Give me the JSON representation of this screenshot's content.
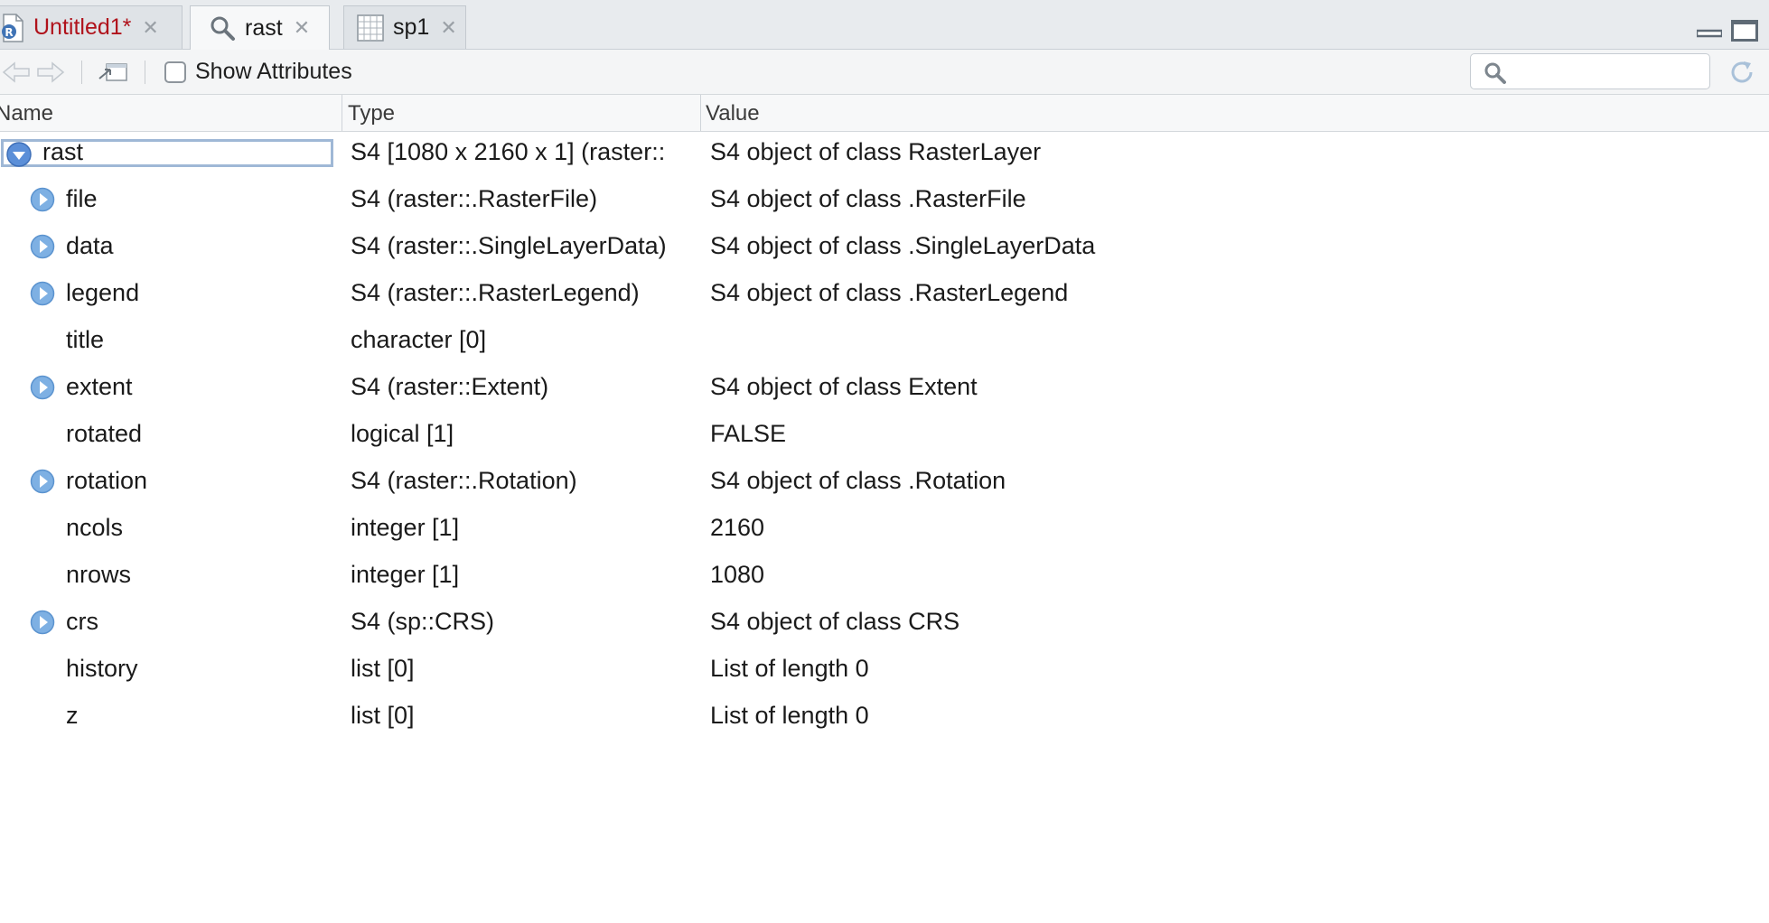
{
  "tabs": [
    {
      "label": "Untitled1*",
      "icon": "r-document-icon",
      "modified": true
    },
    {
      "label": "rast",
      "icon": "magnifier-icon",
      "active": true
    },
    {
      "label": "sp1",
      "icon": "data-grid-icon"
    }
  ],
  "toolbar": {
    "show_attributes_label": "Show Attributes",
    "show_attributes_checked": false,
    "search_placeholder": ""
  },
  "columns": {
    "name": "Name",
    "type": "Type",
    "value": "Value"
  },
  "root": {
    "name": "rast",
    "type": "S4 [1080 x 2160 x 1] (raster::",
    "value": "S4 object of class RasterLayer",
    "expanded": true
  },
  "rows": [
    {
      "name": "file",
      "type": "S4 (raster::.RasterFile)",
      "value": "S4 object of class .RasterFile",
      "expandable": true
    },
    {
      "name": "data",
      "type": "S4 (raster::.SingleLayerData)",
      "value": "S4 object of class .SingleLayerData",
      "expandable": true
    },
    {
      "name": "legend",
      "type": "S4 (raster::.RasterLegend)",
      "value": "S4 object of class .RasterLegend",
      "expandable": true
    },
    {
      "name": "title",
      "type": "character [0]",
      "value": "",
      "expandable": false
    },
    {
      "name": "extent",
      "type": "S4 (raster::Extent)",
      "value": "S4 object of class Extent",
      "expandable": true
    },
    {
      "name": "rotated",
      "type": "logical [1]",
      "value": "FALSE",
      "expandable": false
    },
    {
      "name": "rotation",
      "type": "S4 (raster::.Rotation)",
      "value": "S4 object of class .Rotation",
      "expandable": true
    },
    {
      "name": "ncols",
      "type": "integer [1]",
      "value": "2160",
      "expandable": false
    },
    {
      "name": "nrows",
      "type": "integer [1]",
      "value": "1080",
      "expandable": false
    },
    {
      "name": "crs",
      "type": "S4 (sp::CRS)",
      "value": "S4 object of class CRS",
      "expandable": true
    },
    {
      "name": "history",
      "type": "list [0]",
      "value": "List of length 0",
      "expandable": false
    },
    {
      "name": "z",
      "type": "list [0]",
      "value": "List of length 0",
      "expandable": false
    }
  ],
  "colors": {
    "modified_tab_text": "#b0121b",
    "expander_blue": "#5b9bd5",
    "selection_border": "#9fb8d6"
  }
}
